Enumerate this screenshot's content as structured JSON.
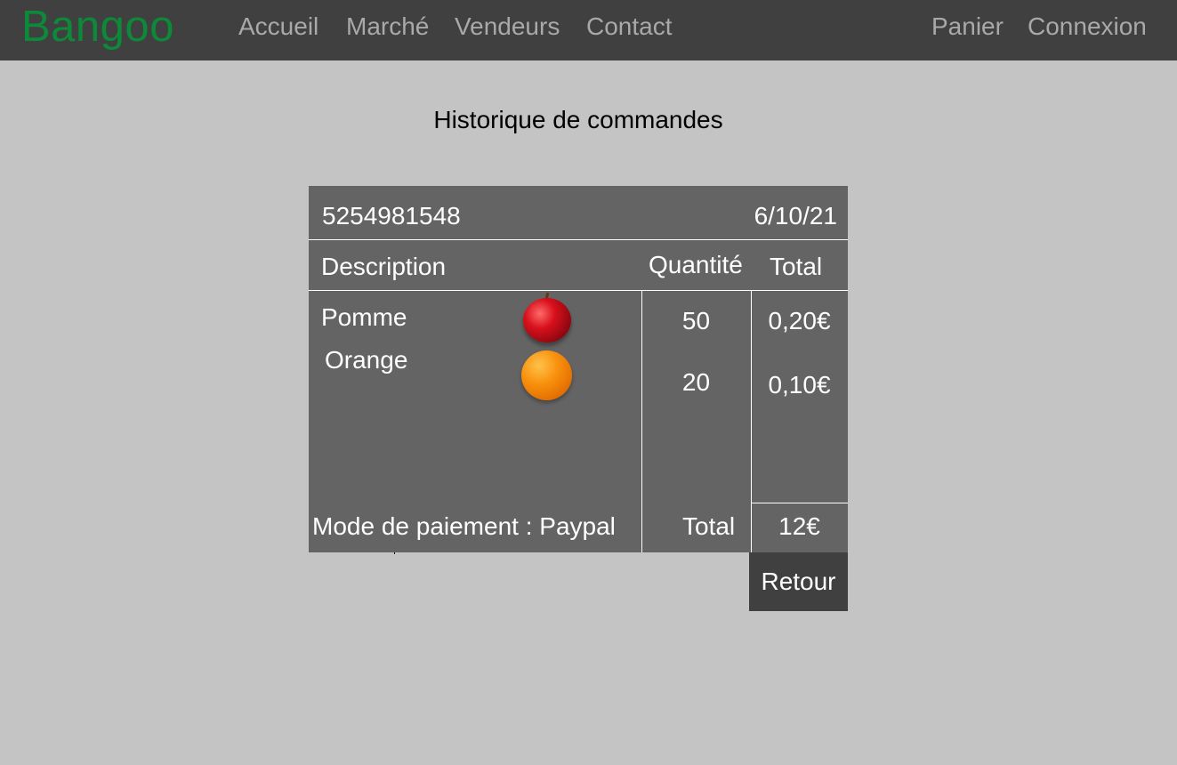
{
  "brand": "Bangoo",
  "nav": {
    "left": [
      "Accueil",
      "Marché",
      "Vendeurs",
      "Contact"
    ],
    "right": [
      "Panier",
      "Connexion"
    ]
  },
  "page": {
    "title": "Historique de commandes"
  },
  "order": {
    "number": "5254981548",
    "date": "6/10/21",
    "columns": {
      "description": "Description",
      "quantity": "Quantité",
      "total": "Total"
    },
    "items": [
      {
        "name": "Pomme",
        "icon": "apple-icon",
        "quantity": "50",
        "total": "0,20€"
      },
      {
        "name": "Orange",
        "icon": "orange-icon",
        "quantity": "20",
        "total": "0,10€"
      }
    ],
    "payment": "Mode de paiement : Paypal",
    "total_label": "Total",
    "total_value": "12€"
  },
  "actions": {
    "back": "Retour"
  },
  "colors": {
    "background": "#c4c4c4",
    "navbar": "#404040",
    "brand": "#0c8a3a",
    "nav_link": "#a9a9a9",
    "card": "#646464",
    "button": "#404040"
  }
}
